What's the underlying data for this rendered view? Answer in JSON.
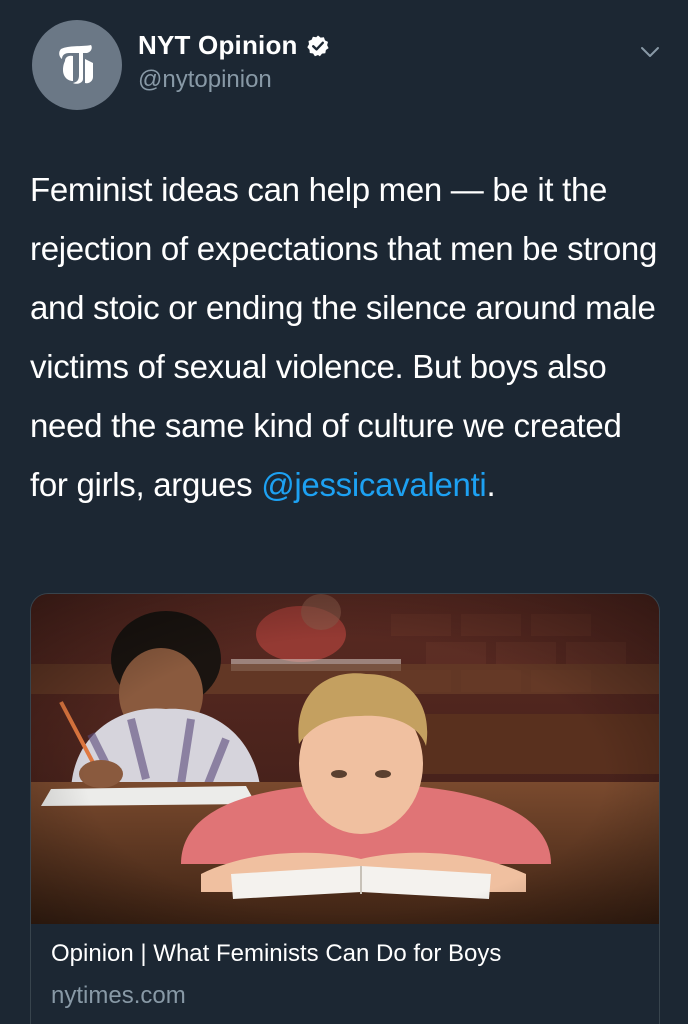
{
  "account": {
    "display_name": "NYT Opinion",
    "handle": "@nytopinion",
    "avatar_icon": "nyt-logo-icon",
    "verified_icon": "verified-badge-icon",
    "menu_icon": "chevron-down-icon"
  },
  "tweet": {
    "text_before_mention": "Feminist ideas can help men — be it the rejection of expectations that men be strong and stoic or ending the silence around male victims of sexual violence. But boys also need the same kind of culture we created for girls, argues ",
    "mention": "@jessicavalenti",
    "text_after_mention": "."
  },
  "link_card": {
    "image_description_icon": "article-photo",
    "title": "Opinion | What Feminists Can Do for Boys",
    "domain": "nytimes.com"
  },
  "colors": {
    "background": "#1c2733",
    "text_primary": "#ffffff",
    "text_secondary": "#8899a6",
    "link": "#1da1f2",
    "border": "#38444d"
  }
}
